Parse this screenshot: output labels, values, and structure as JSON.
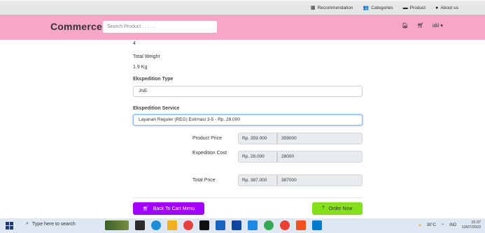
{
  "topnav": {
    "items": [
      {
        "icon": "list-icon",
        "label": "Recommendation"
      },
      {
        "icon": "people-icon",
        "label": "Categories"
      },
      {
        "icon": "box-icon",
        "label": "Product"
      },
      {
        "icon": "info-icon",
        "label": "About us"
      }
    ]
  },
  "header": {
    "brand": "Commerce",
    "search_placeholder": "Search Product . . . . .",
    "home_icon": "home-icon",
    "cart_icon": "cart-icon",
    "user_label": "idil",
    "user_caret": "▾"
  },
  "form": {
    "quantity_value": "4",
    "total_weight_label": "Total Weight",
    "total_weight_value": "1.9 Kg",
    "expedition_type_label": "Ekspedition Type",
    "expedition_type_value": "JNE",
    "expedition_service_label": "Ekspedition Service",
    "expedition_service_value": "Layanan Reguler (REG) Estimasi 3-5 - Rp. 28.000"
  },
  "pricing": {
    "rows": [
      {
        "label": "Product Price",
        "formatted": "Rp. 359.000",
        "raw": "359000"
      },
      {
        "label": "Expedition Cost",
        "formatted": "Rp. 28.000",
        "raw": "28000"
      },
      {
        "label": "Total Price",
        "formatted": "Rp. 387.000",
        "raw": "387000"
      }
    ]
  },
  "actions": {
    "back_label": "Back To Cart Menu",
    "order_label": "Order Now"
  },
  "taskbar": {
    "search_placeholder": "Type here to search",
    "temperature": "30°C",
    "lang": "IND",
    "time": "15:37",
    "date": "13/07/2023"
  },
  "colors": {
    "header_pink": "#f7a6c8",
    "back_button": "#a200ff",
    "order_button": "#85e01c"
  }
}
